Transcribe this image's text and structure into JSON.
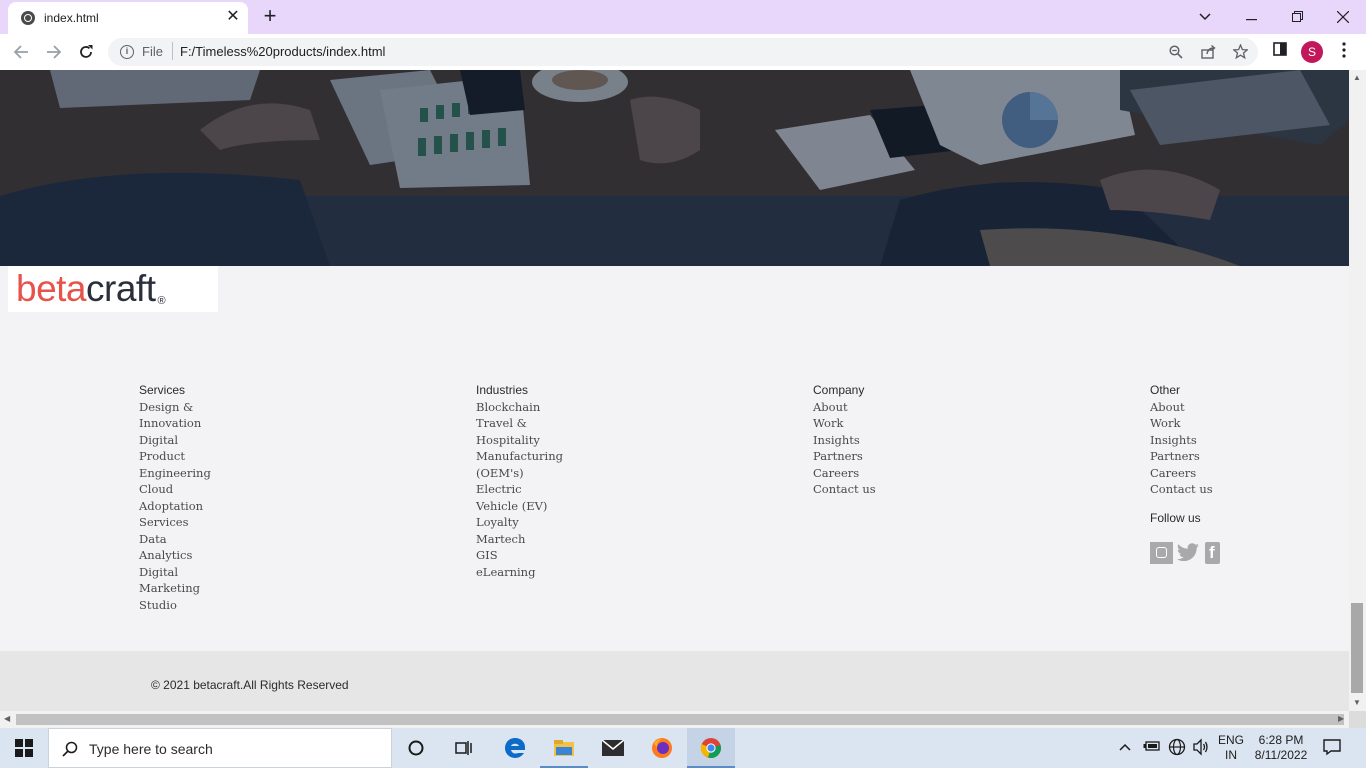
{
  "browser": {
    "tab_title": "index.html",
    "tab_close": "✕",
    "new_tab": "+",
    "file_label": "File",
    "url": "F:/Timeless%20products/index.html",
    "profile_initial": "S"
  },
  "logo": {
    "beta": "beta",
    "craft": "craft",
    "reg": "®"
  },
  "footer": {
    "columns": [
      {
        "heading": "Services",
        "items": [
          "Design &",
          "Innovation",
          "Digital",
          "Product",
          "Engineering",
          "Cloud",
          "Adoptation",
          "Services",
          "Data",
          "Analytics",
          "Digital",
          "Marketing",
          "Studio"
        ]
      },
      {
        "heading": "Industries",
        "items": [
          "Blockchain",
          "Travel &",
          "Hospitality",
          "Manufacturing",
          "(OEM's)",
          "Electric",
          "Vehicle (EV)",
          "Loyalty",
          "Martech",
          "GIS",
          "eLearning"
        ]
      },
      {
        "heading": "Company",
        "items": [
          "About",
          "Work",
          "Insights",
          "Partners",
          "Careers",
          "Contact us"
        ]
      },
      {
        "heading": "Other",
        "items": [
          "About",
          "Work",
          "Insights",
          "Partners",
          "Careers",
          "Contact us"
        ]
      }
    ],
    "follow_label": "Follow us",
    "copyright": "© 2021 betacraft.All Rights Reserved"
  },
  "taskbar": {
    "search_placeholder": "Type here to search",
    "language": "ENG",
    "region": "IN",
    "time": "6:28 PM",
    "date": "8/11/2022"
  },
  "colors": {
    "brand_red": "#e5534b",
    "brand_dark": "#2a2f3a",
    "tab_bar": "#e9d6fb"
  }
}
